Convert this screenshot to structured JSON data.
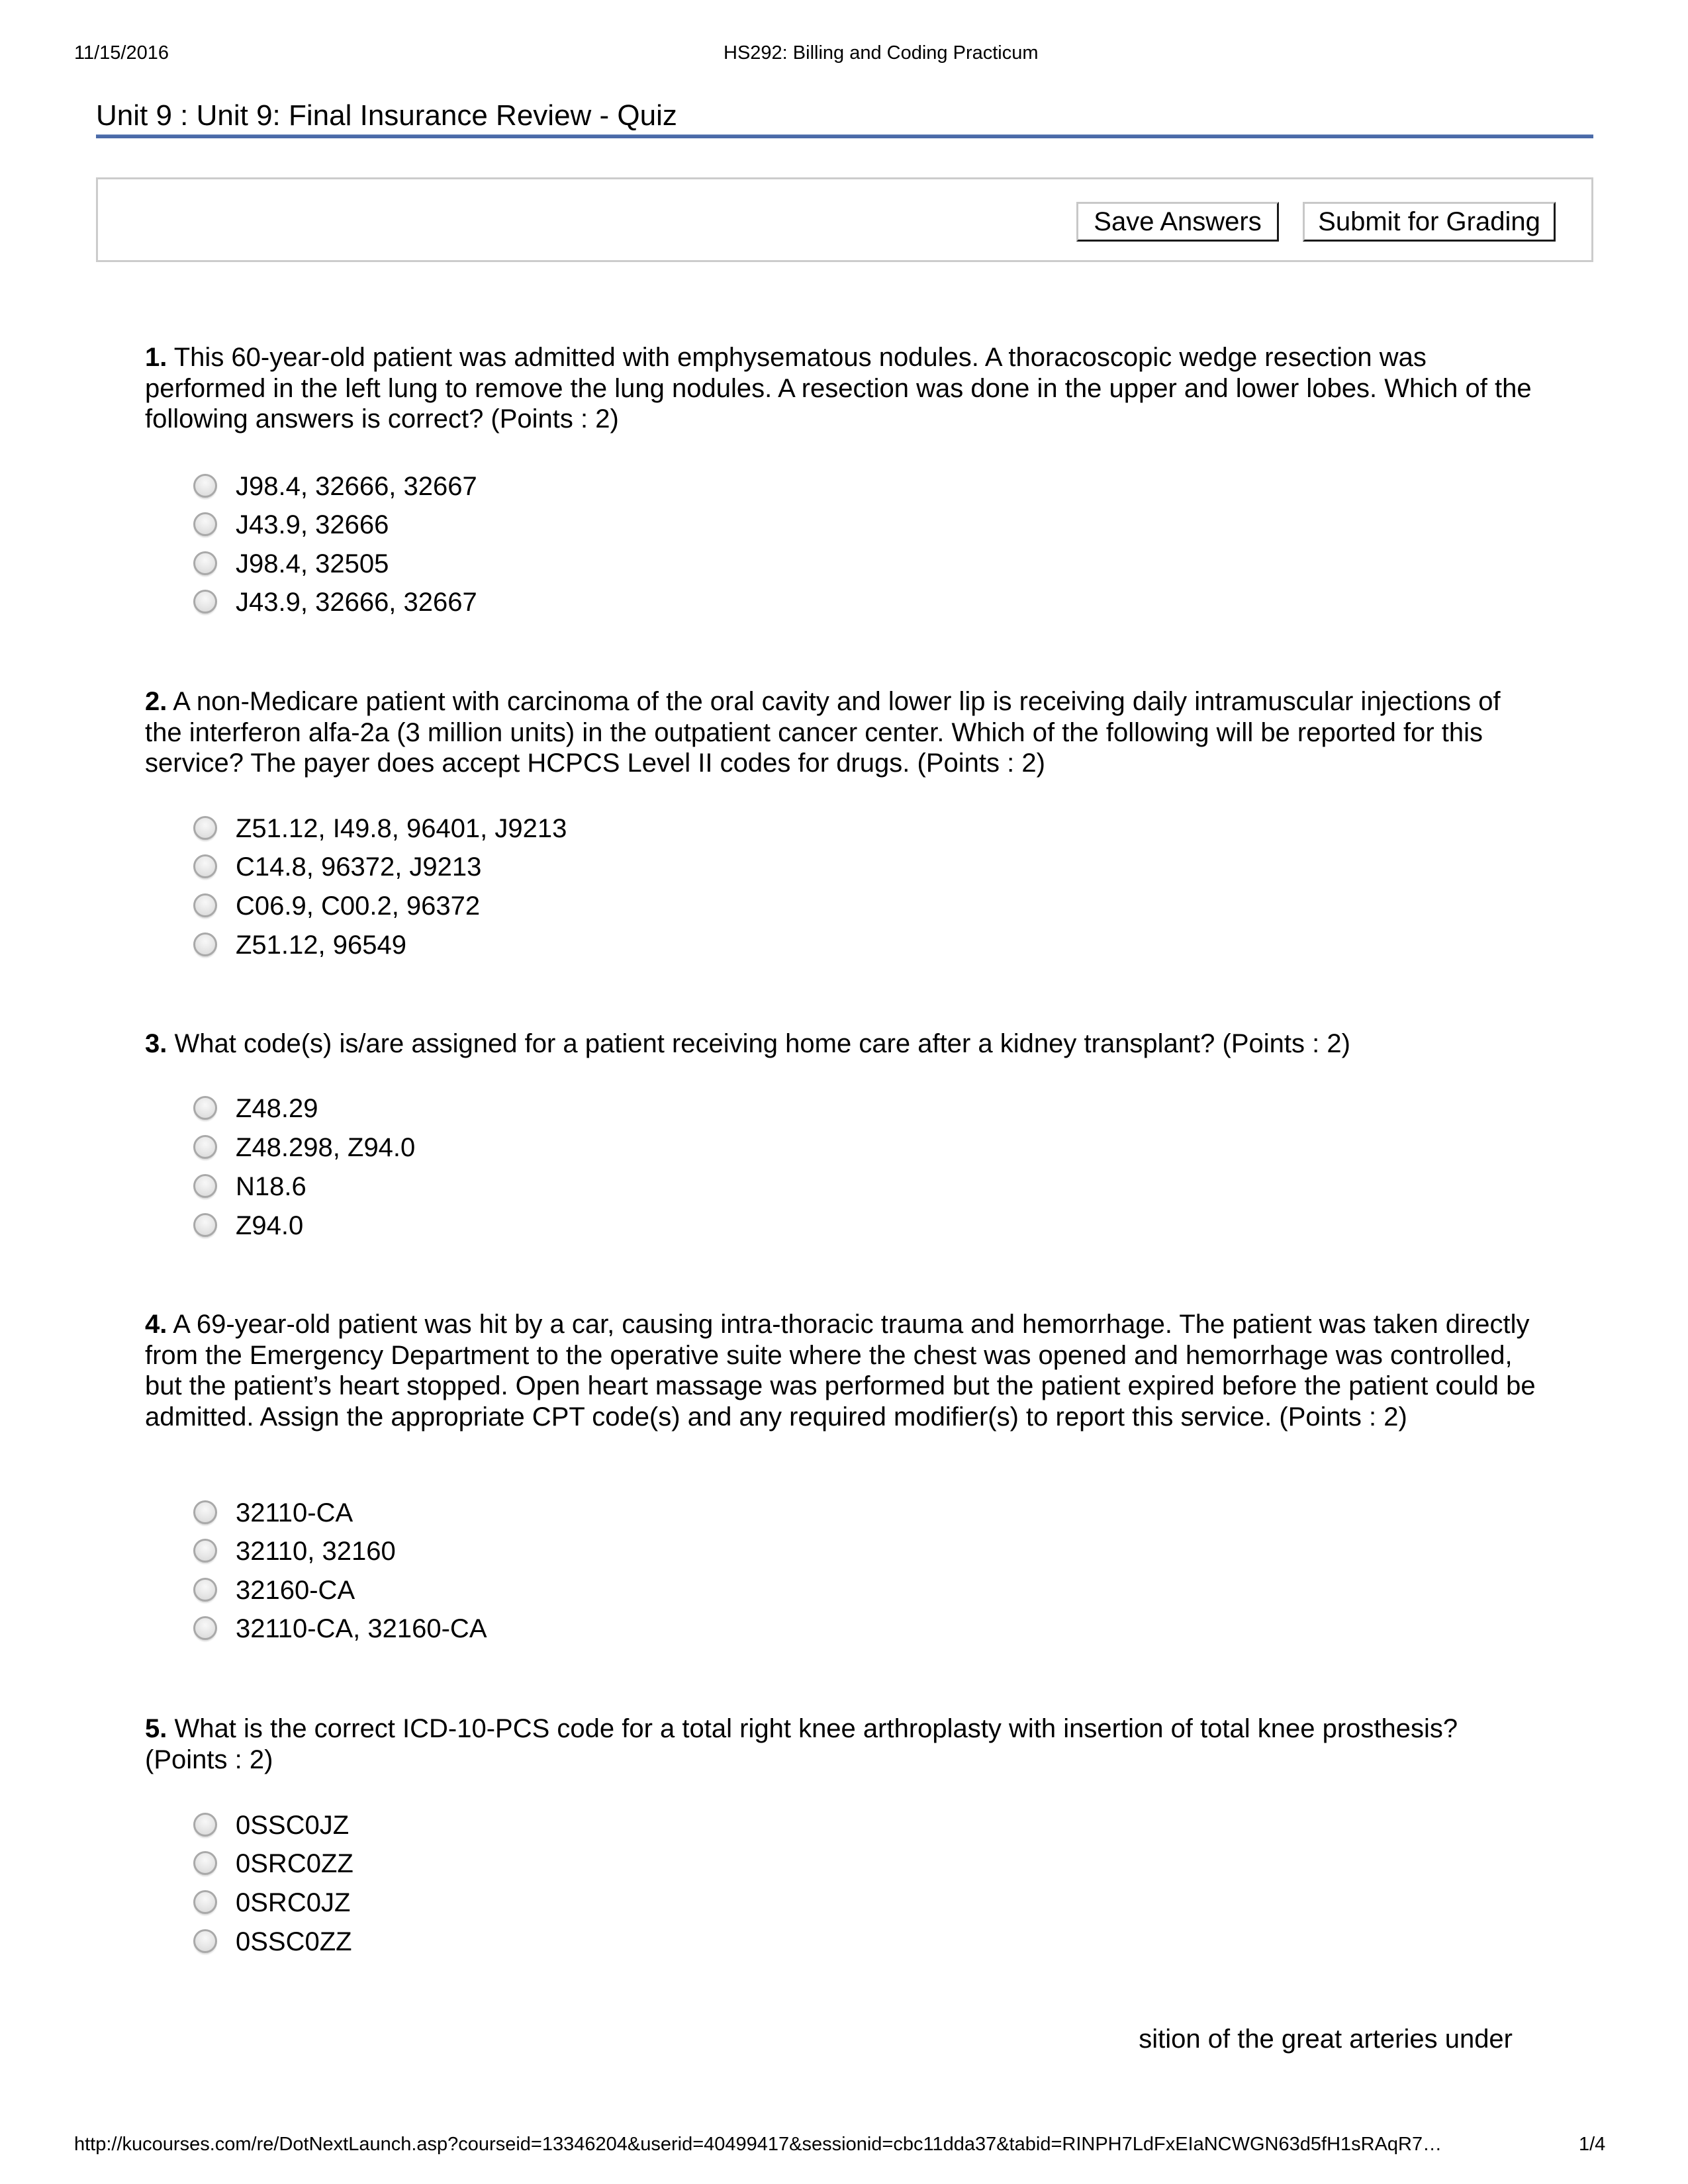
{
  "print_header": {
    "date": "11/15/2016",
    "course_title": "HS292: Billing and Coding Practicum"
  },
  "page_title": "Unit 9 : Unit 9: Final Insurance Review - Quiz",
  "toolbar": {
    "save_label": "Save Answers",
    "submit_label": "Submit for Grading"
  },
  "questions": [
    {
      "number": "1.",
      "text": "This 60-year-old patient was admitted with emphysematous nodules.  A thoracoscopic wedge resection was performed in the left lung to remove the lung nodules.  A resection was done in the upper and lower lobes.  Which of the following answers is correct? (Points : 2)",
      "options": [
        "J98.4, 32666, 32667",
        "J43.9, 32666",
        "J98.4, 32505",
        "J43.9, 32666, 32667"
      ],
      "selected": null
    },
    {
      "number": "2.",
      "text": "A non-Medicare patient with carcinoma of the oral cavity and lower lip is receiving daily intramuscular injections of the interferon alfa-2a (3 million units) in the outpatient cancer center.  Which of the following will be reported for this service?  The payer does accept HCPCS Level II codes for drugs. (Points : 2)",
      "options": [
        "Z51.12, I49.8, 96401, J9213",
        "C14.8, 96372, J9213",
        "C06.9, C00.2, 96372",
        "Z51.12, 96549"
      ],
      "selected": null
    },
    {
      "number": "3.",
      "text": "What code(s) is/are assigned for a patient receiving home care after a kidney transplant? (Points : 2)",
      "options": [
        "Z48.29",
        "Z48.298, Z94.0",
        "N18.6",
        "Z94.0"
      ],
      "selected": null
    },
    {
      "number": "4.",
      "text": "A 69-year-old patient was hit by a car, causing intra-thoracic trauma and hemorrhage.  The patient was taken directly from the Emergency Department to the operative suite where the chest was opened and hemorrhage was controlled, but the patient’s heart stopped.  Open heart massage was performed but the patient expired before the patient could be admitted.  Assign the appropriate CPT code(s) and any required modifier(s) to report this service. (Points : 2)",
      "options": [
        "32110-CA",
        "32110, 32160",
        "32160-CA",
        "32110-CA, 32160-CA"
      ],
      "selected": null
    },
    {
      "number": "5.",
      "text": "What is the correct ICD-10-PCS code for a total right knee arthroplasty with insertion of total knee prosthesis? (Points : 2)",
      "options": [
        "0SSC0JZ",
        "0SRC0ZZ",
        "0SRC0JZ",
        "0SSC0ZZ"
      ],
      "selected": null
    }
  ],
  "partial_text": "sition of the great arteries under",
  "print_footer": {
    "url": "http://kucourses.com/re/DotNextLaunch.asp?courseid=13346204&userid=40499417&sessionid=cbc11dda37&tabid=RINPH7LdFxEIaNCWGN63d5fH1sRAqR7…",
    "page": "1/4"
  },
  "colors": {
    "title_rule": "#4a6aa8",
    "frame_border": "#cccccc"
  }
}
